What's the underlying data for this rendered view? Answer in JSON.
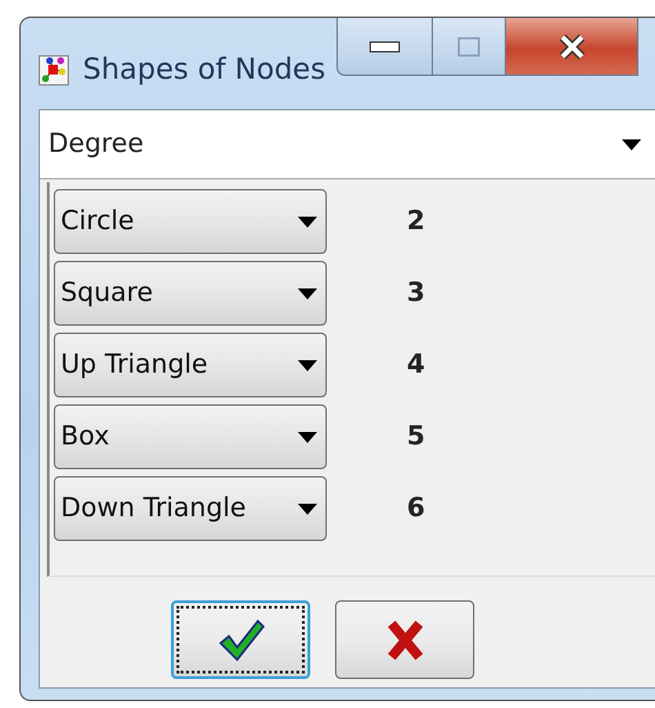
{
  "window": {
    "title": "Shapes of Nodes"
  },
  "attribute": {
    "value": "Degree"
  },
  "shapes": [
    {
      "shape": "Circle",
      "value": "2"
    },
    {
      "shape": "Square",
      "value": "3"
    },
    {
      "shape": "Up Triangle",
      "value": "4"
    },
    {
      "shape": "Box",
      "value": "5"
    },
    {
      "shape": "Down Triangle",
      "value": "6"
    }
  ],
  "buttons": [
    {
      "kind": "ok",
      "focused": true
    },
    {
      "kind": "cancel",
      "focused": false
    }
  ]
}
